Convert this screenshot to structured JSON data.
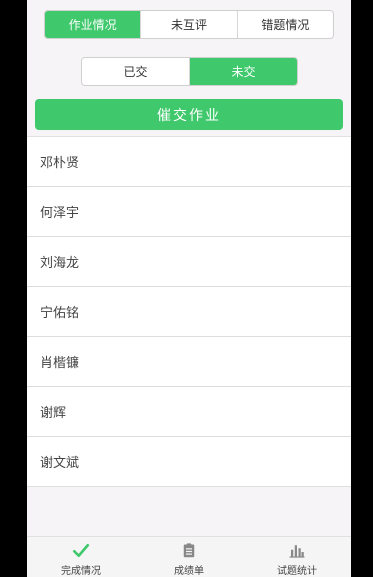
{
  "segments_top": [
    {
      "label": "作业情况",
      "active": true
    },
    {
      "label": "未互评",
      "active": false
    },
    {
      "label": "错题情况",
      "active": false
    }
  ],
  "segments_sub": [
    {
      "label": "已交",
      "active": false
    },
    {
      "label": "未交",
      "active": true
    }
  ],
  "urge_button": "催交作业",
  "students": [
    "邓朴贤",
    "何泽宇",
    "刘海龙",
    "宁佑铭",
    "肖楷镰",
    "谢辉",
    "谢文斌"
  ],
  "tabbar": [
    {
      "label": "完成情况",
      "icon": "check-icon"
    },
    {
      "label": "成绩单",
      "icon": "clipboard-icon"
    },
    {
      "label": "试题统计",
      "icon": "bar-chart-icon"
    }
  ],
  "colors": {
    "accent": "#3fc86c",
    "tab_icon": "#888888"
  }
}
